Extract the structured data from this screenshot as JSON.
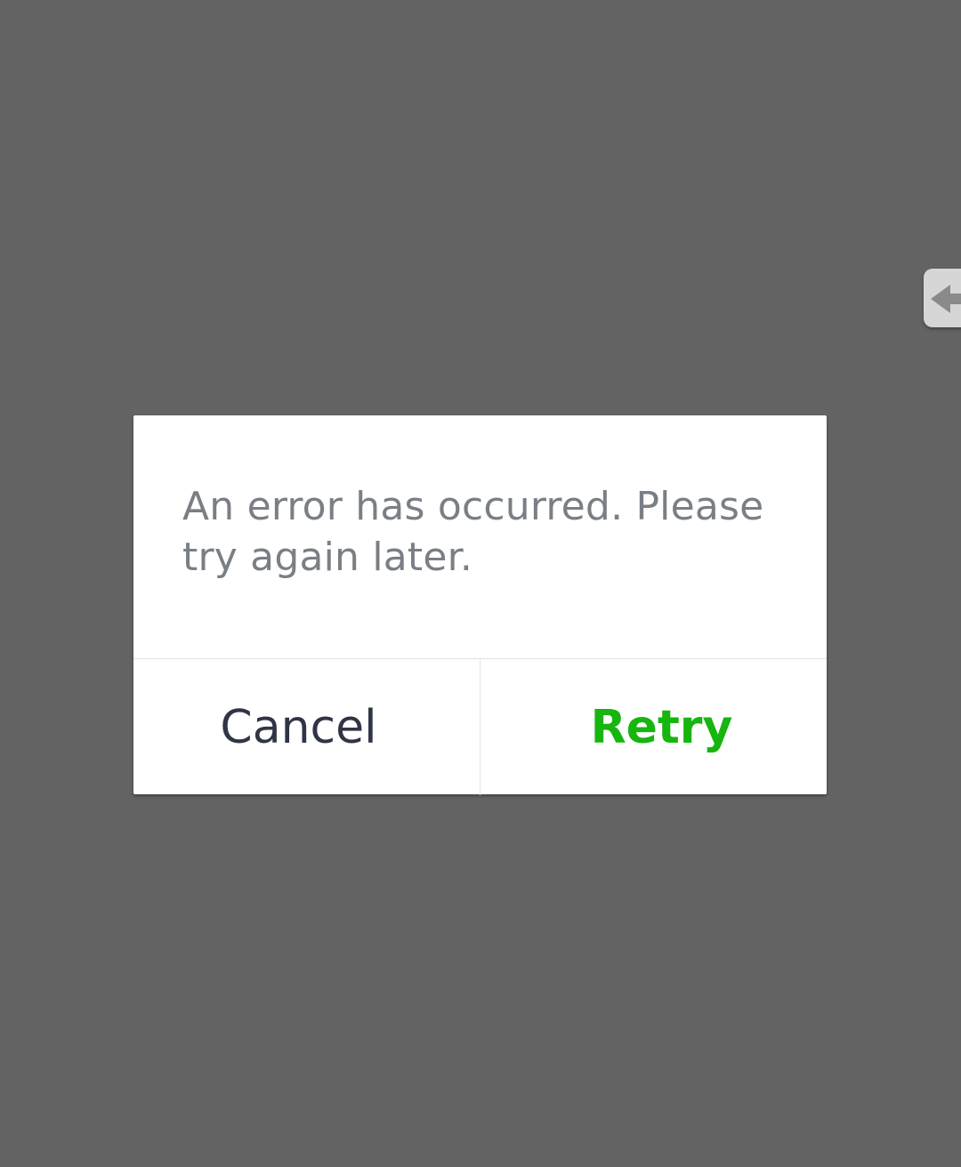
{
  "dialog": {
    "message": "An error has occurred. Please try again later.",
    "cancel_label": "Cancel",
    "retry_label": "Retry"
  },
  "side_tab": {
    "icon": "arrow-left-icon"
  },
  "colors": {
    "overlay": "#636363",
    "retry_accent": "#17b50f",
    "message_text": "#7a7f86",
    "cancel_text": "#2f3545"
  }
}
